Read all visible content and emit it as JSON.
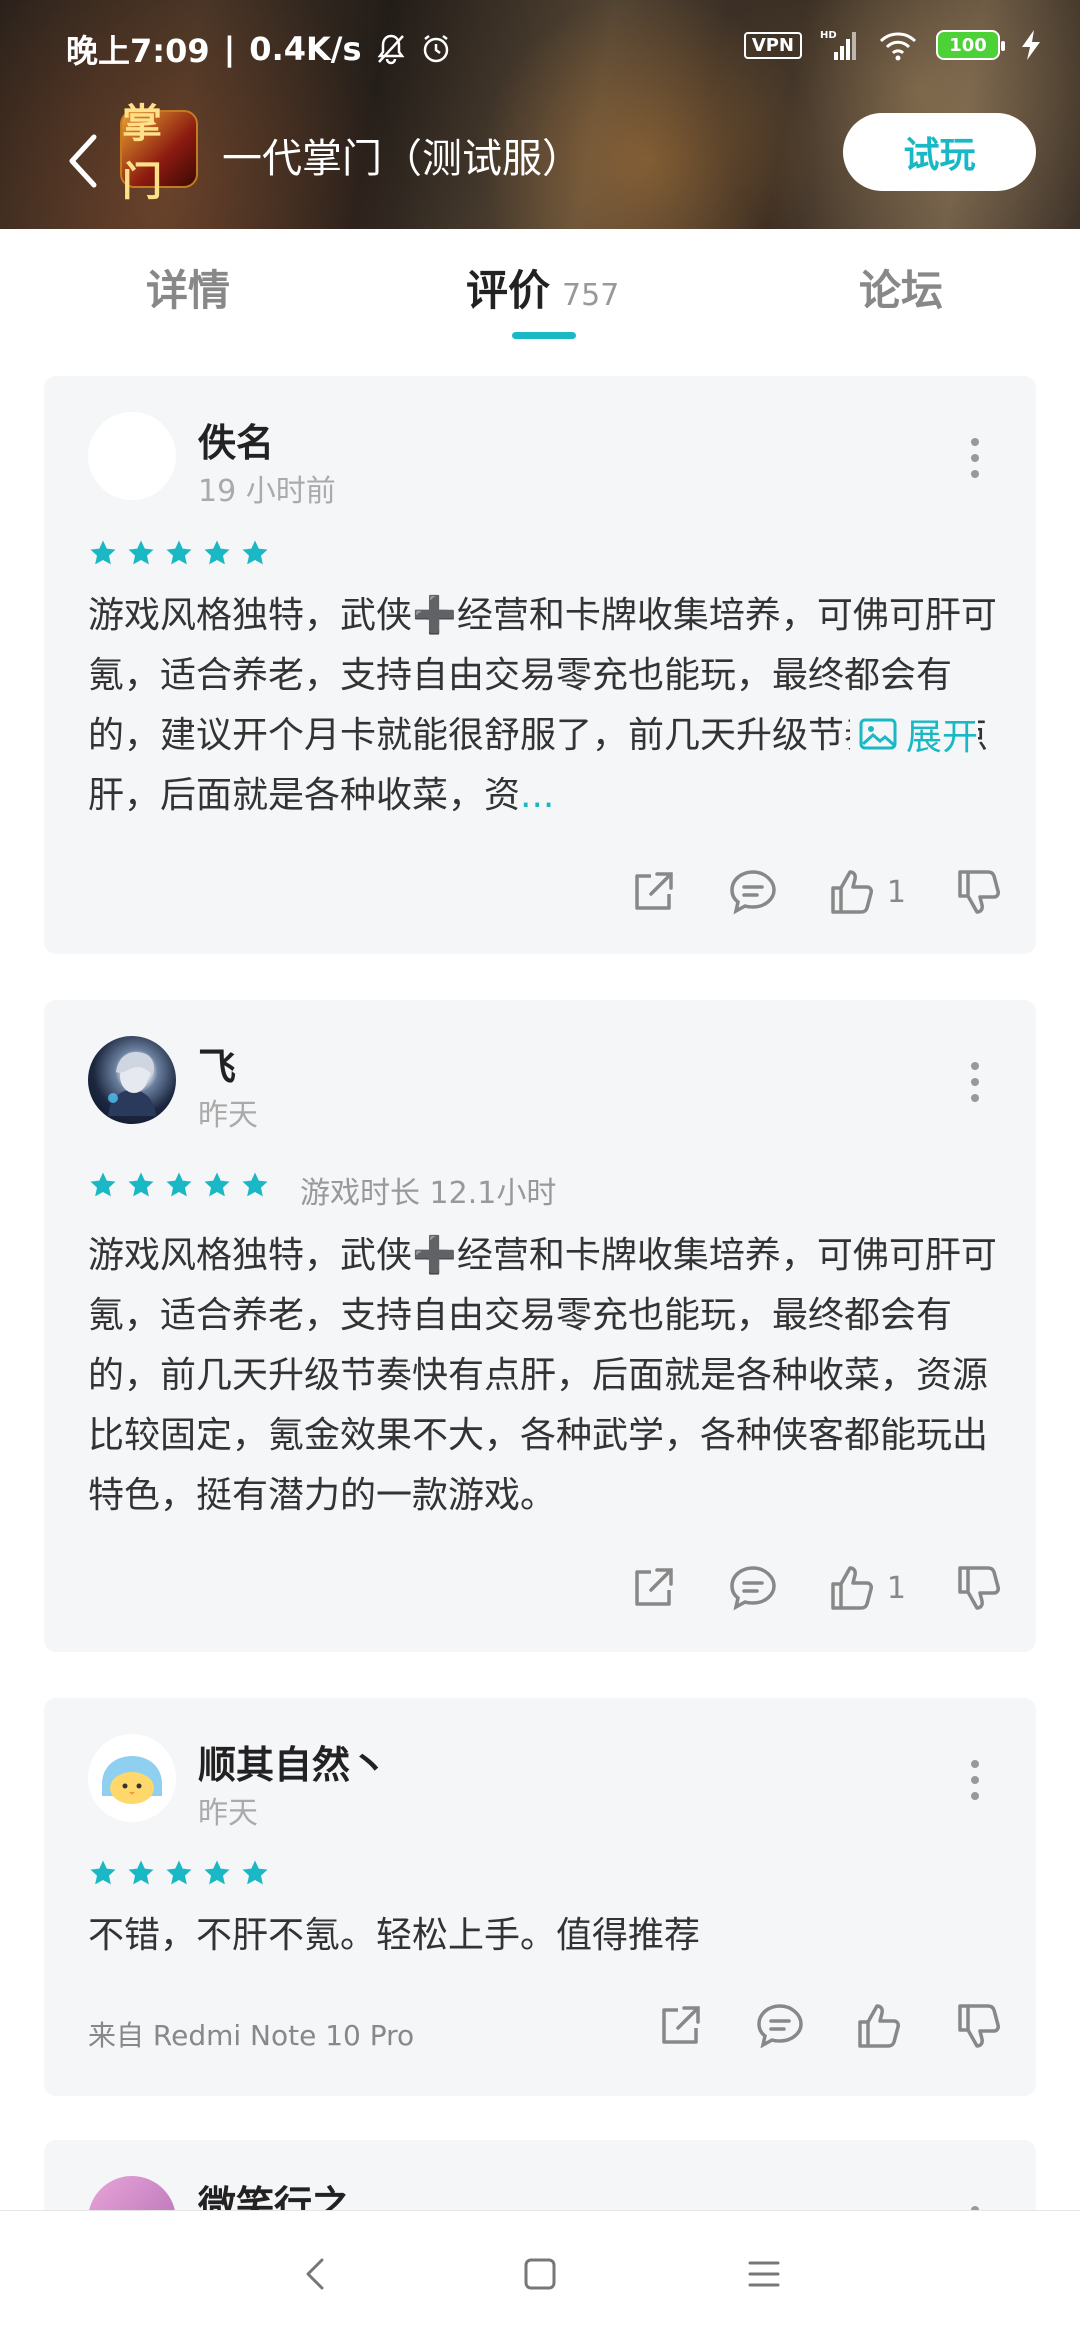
{
  "status_bar": {
    "time": "晚上7:09",
    "network_speed": "0.4K/s",
    "vpn": "VPN",
    "signal": "HD",
    "battery": "100"
  },
  "app_bar": {
    "app_icon_text": "掌门",
    "title": "一代掌门（测试服）",
    "try_button": "试玩"
  },
  "tabs": [
    {
      "label": "详情"
    },
    {
      "label": "评价",
      "count": "757"
    },
    {
      "label": "论坛"
    }
  ],
  "reviews": [
    {
      "name": "佚名",
      "time": "19 小时前",
      "rating": 5,
      "text": "游戏风格独特，武侠➕经营和卡牌收集培养，可佛可肝可氪，适合养老，支持自由交易零充也能玩，最终都会有的，建议开个月卡就能很舒服了，前几天升级节奏快有点肝，后面就是各种收菜，资",
      "ellipsis": "...",
      "expand_label": "展开",
      "likes": "1"
    },
    {
      "name": "飞",
      "time": "昨天",
      "rating": 5,
      "playtime": "游戏时长 12.1小时",
      "text": "游戏风格独特，武侠➕经营和卡牌收集培养，可佛可肝可氪，适合养老，支持自由交易零充也能玩，最终都会有的，前几天升级节奏快有点肝，后面就是各种收菜，资源比较固定，氪金效果不大，各种武学，各种侠客都能玩出特色，挺有潜力的一款游戏。",
      "likes": "1"
    },
    {
      "name": "顺其自然丶",
      "time": "昨天",
      "rating": 5,
      "text": "不错，不肝不氪。轻松上手。值得推荐",
      "device": "来自 Redmi Note 10 Pro"
    },
    {
      "name": "微笑行之"
    }
  ],
  "colors": {
    "accent": "#1ab8c4",
    "card_bg": "#f5f6f8"
  }
}
